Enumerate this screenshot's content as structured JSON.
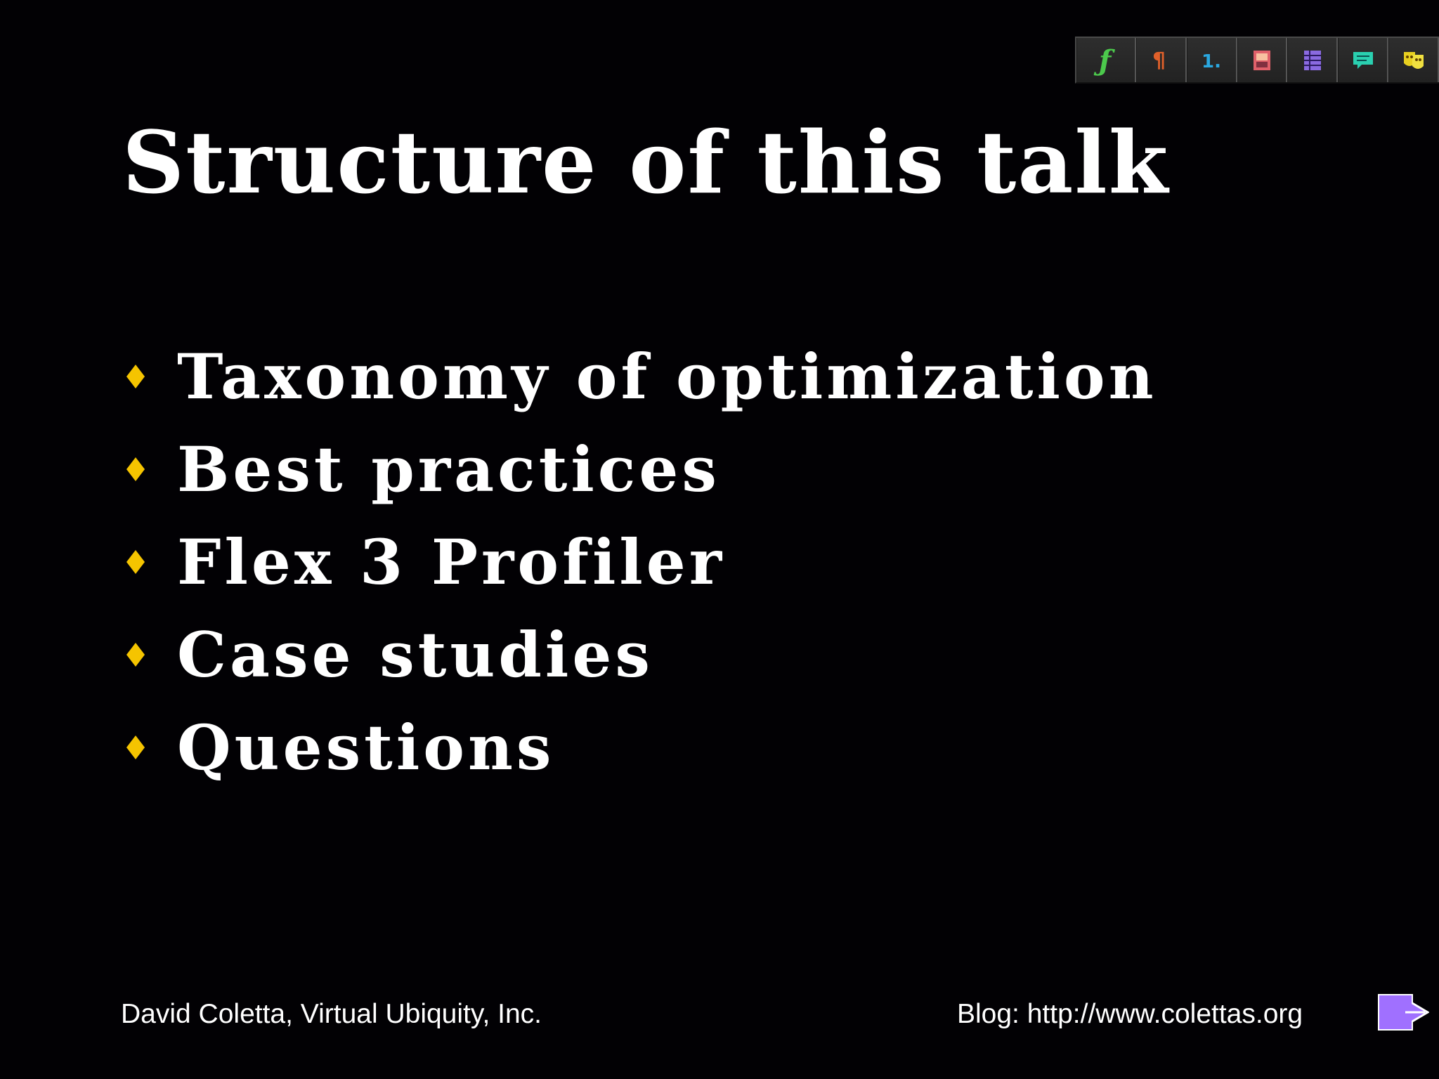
{
  "toolbar": {
    "buttons": [
      {
        "icon": "function-icon",
        "glyph": "ƒ",
        "color": "#4cc94c"
      },
      {
        "icon": "paragraph-icon",
        "glyph": "¶",
        "color": "#e0602a"
      },
      {
        "icon": "numbered-list-icon",
        "glyph": "1.",
        "color": "#2aa8e0"
      },
      {
        "icon": "image-icon",
        "color": "#e0606a"
      },
      {
        "icon": "table-icon",
        "color": "#8a6ae0"
      },
      {
        "icon": "comment-icon",
        "color": "#2ad0b0"
      },
      {
        "icon": "theater-masks-icon",
        "color": "#e8d020"
      }
    ]
  },
  "slide": {
    "title": "Structure of this talk",
    "bullet_color": "#f5c400",
    "bullets": [
      "Taxonomy of optimization",
      "Best practices",
      "Flex 3 Profiler",
      "Case studies",
      "Questions"
    ]
  },
  "footer": {
    "left": "David Coletta, Virtual Ubiquity, Inc.",
    "right": "Blog: http://www.colettas.org",
    "next_icon": "next-slide-arrow-icon",
    "next_color": "#a070ff"
  }
}
